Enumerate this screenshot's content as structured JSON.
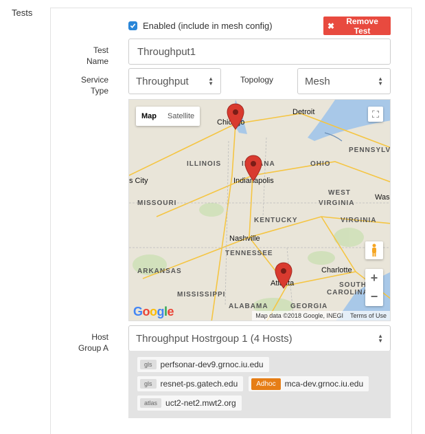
{
  "section": {
    "label": "Tests"
  },
  "test": {
    "enabled_label": "Enabled (include in mesh config)",
    "remove_label": "Remove Test",
    "name_label_1": "Test",
    "name_label_2": "Name",
    "name_value": "Throughput1",
    "service_label_1": "Service",
    "service_label_2": "Type",
    "service_value": "Throughput",
    "topology_label": "Topology",
    "topology_value": "Mesh"
  },
  "map": {
    "type_map": "Map",
    "type_satellite": "Satellite",
    "states": [
      "ILLINOIS",
      "INDIANA",
      "OHIO",
      "PENNSYLVANIA",
      "MISSOURI",
      "WEST",
      "VIRGINIA",
      "KENTUCKY",
      "VIRGINIA",
      "TENNESSEE",
      "ARKANSAS",
      "MISSISSIPPI",
      "ALABAMA",
      "GEORGIA",
      "SOUTH",
      "CAROLINA"
    ],
    "cities": [
      "Chicago",
      "Detroit",
      "Indianapolis",
      "s City",
      "Nashville",
      "Atlanta",
      "Charlotte",
      "Was"
    ],
    "footer_data": "Map data ©2018 Google, INEGI",
    "footer_terms": "Terms of Use",
    "google_text": "Google",
    "zoom_in": "+",
    "zoom_out": "−"
  },
  "host_group": {
    "label_1": "Host",
    "label_2": "Group A",
    "value": "Throughput Hostrgoup 1 (4 Hosts)",
    "hosts": [
      {
        "tag": "gls",
        "name": "perfsonar-dev9.grnoc.iu.edu"
      },
      {
        "tag": "gls",
        "name": "resnet-ps.gatech.edu"
      },
      {
        "tag": "Adhoc",
        "name": "mca-dev.grnoc.iu.edu"
      },
      {
        "tag": "atlas",
        "name": "uct2-net2.mwt2.org"
      }
    ]
  },
  "colors": {
    "remove": "#e84a3f",
    "checkbox": "#2a86d8",
    "adhoc": "#e67e16",
    "pin": "#d93a2f"
  }
}
